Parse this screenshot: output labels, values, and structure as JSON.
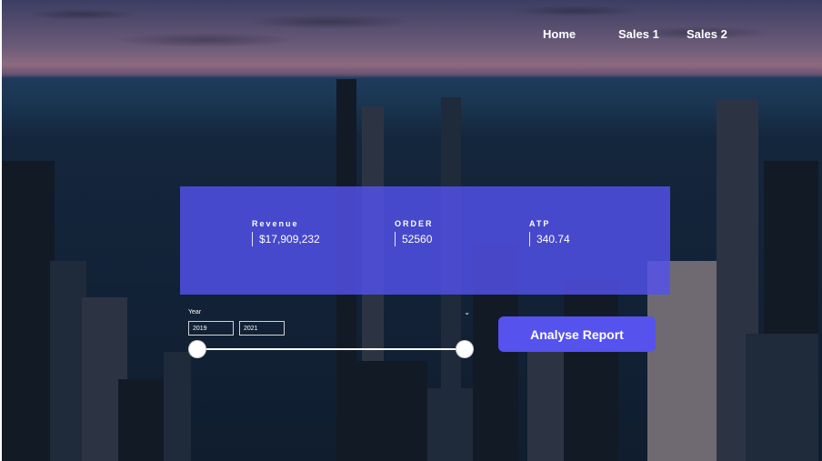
{
  "nav": {
    "items": [
      "Home",
      "Sales 1",
      "Sales 2"
    ]
  },
  "kpis": [
    {
      "label": "Revenue",
      "value": "$17,909,232"
    },
    {
      "label": "ORDER",
      "value": "52560"
    },
    {
      "label": "ATP",
      "value": "340.74"
    }
  ],
  "slicer": {
    "title": "Year",
    "start": "2019",
    "end": "2021",
    "range_fraction": [
      0,
      1
    ]
  },
  "report_button": {
    "label": "Analyse Report"
  },
  "colors": {
    "accent": "#5552ee",
    "card": "#5352ed"
  }
}
